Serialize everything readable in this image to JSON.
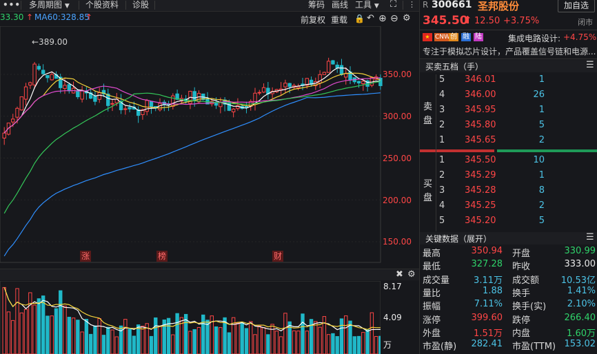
{
  "toolbar": {
    "menu_icon": "menu-dots-icon",
    "period_label": "多周期图",
    "stock_info_label": "个股资料",
    "diagnose_label": "诊股",
    "chips_label": "筹码",
    "draw_label": "画线",
    "tools_label": "工具",
    "fuquan_label": "前复权",
    "reweight_label": "重载"
  },
  "ma_legend": {
    "left_value": "33.30",
    "ma60": "MA60:328.85"
  },
  "price_axis": {
    "ticks": [
      "350.00",
      "300.00",
      "250.00",
      "200.00",
      "150.00"
    ],
    "high_annotation": "←389.00"
  },
  "event_markers": [
    "涨",
    "榜",
    "财"
  ],
  "volume_axis": {
    "ticks": [
      "8.17",
      "4.09",
      "万"
    ]
  },
  "header": {
    "prefix": "R",
    "code": "300661",
    "name": "圣邦股份",
    "add_watch": "加自选",
    "price": "345.50",
    "change": "12.50",
    "change_pct": "+3.75%",
    "status": "闭市"
  },
  "tags": {
    "badges": [
      "CNW",
      "创",
      "融",
      "陆"
    ],
    "sector": "集成电路设计:",
    "sector_pct": "+4.75%",
    "description": "专注于模拟芯片设计，产品覆盖信号链和电源..."
  },
  "order_book": {
    "title": "买卖五档（手）",
    "sell_label": [
      "卖",
      "盘"
    ],
    "buy_label": [
      "买",
      "盘"
    ],
    "sells": [
      {
        "level": "5",
        "price": "346.01",
        "vol": "1"
      },
      {
        "level": "4",
        "price": "346.00",
        "vol": "26"
      },
      {
        "level": "3",
        "price": "345.95",
        "vol": "1"
      },
      {
        "level": "2",
        "price": "345.80",
        "vol": "5"
      },
      {
        "level": "1",
        "price": "345.65",
        "vol": "2"
      }
    ],
    "buys": [
      {
        "level": "1",
        "price": "345.50",
        "vol": "10"
      },
      {
        "level": "2",
        "price": "345.29",
        "vol": "1"
      },
      {
        "level": "3",
        "price": "345.28",
        "vol": "8"
      },
      {
        "level": "4",
        "price": "345.25",
        "vol": "2"
      },
      {
        "level": "5",
        "price": "345.20",
        "vol": "5"
      }
    ]
  },
  "key_data": {
    "title": "关键数据（展开）",
    "rows": [
      {
        "l1": "最高",
        "v1": "350.94",
        "c1": "#ff4646",
        "l2": "开盘",
        "v2": "330.99",
        "c2": "#2fd36a"
      },
      {
        "l1": "最低",
        "v1": "327.28",
        "c1": "#2fd36a",
        "l2": "昨收",
        "v2": "333.00",
        "c2": "#eaeaea"
      },
      {
        "l1": "成交量",
        "v1": "3.11万",
        "c1": "#4cc3e6",
        "l2": "成交额",
        "v2": "10.53亿",
        "c2": "#4cc3e6"
      },
      {
        "l1": "量比",
        "v1": "1.88",
        "c1": "#4cc3e6",
        "l2": "换手",
        "v2": "1.41%",
        "c2": "#4cc3e6"
      },
      {
        "l1": "振幅",
        "v1": "7.11%",
        "c1": "#4cc3e6",
        "l2": "换手(实)",
        "v2": "2.10%",
        "c2": "#4cc3e6"
      },
      {
        "l1": "涨停",
        "v1": "399.60",
        "c1": "#ff4646",
        "l2": "跌停",
        "v2": "266.40",
        "c2": "#2fd36a"
      },
      {
        "l1": "外盘",
        "v1": "1.51万",
        "c1": "#ff4646",
        "l2": "内盘",
        "v2": "1.60万",
        "c2": "#2fd36a"
      },
      {
        "l1": "市盈(静)",
        "v1": "282.41",
        "c1": "#4cc3e6",
        "l2": "市盈(TTM)",
        "v2": "153.02",
        "c2": "#4cc3e6"
      }
    ]
  },
  "colors": {
    "up": "#ff4646",
    "down": "#20b8c8",
    "ma5": "#ffffff",
    "ma10": "#f5d33a",
    "ma20": "#e04bd0",
    "ma30": "#34c759",
    "ma60": "#2f8fff"
  }
}
